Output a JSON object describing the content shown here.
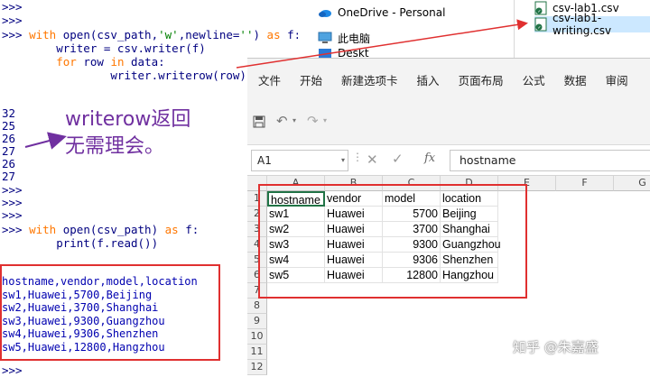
{
  "shell": {
    "prompt1": ">>>",
    "prompt2": ">>>",
    "line_with1": {
      "prompt": ">>> ",
      "kw_with": "with",
      "pre": " open(csv_path,",
      "str_w": "'w'",
      "mid": ",newline=",
      "str_empty": "''",
      "post": ") ",
      "kw_as": "as",
      "tail": " f:"
    },
    "line_writer": "        writer = csv.writer(f)",
    "line_for": {
      "indent": "        ",
      "kw_for": "for",
      "mid": " row ",
      "kw_in": "in",
      "tail": " data:"
    },
    "line_writerow": "                writer.writerow(row)",
    "returns": [
      "32",
      "25",
      "26",
      "27",
      "26",
      "27"
    ],
    "prompts_after": [
      ">>>",
      ">>>",
      ">>>"
    ],
    "line_with2": {
      "prompt": ">>> ",
      "kw_with": "with",
      "pre": " open(csv_path) ",
      "kw_as": "as",
      "tail": " f:"
    },
    "line_print": "        print(f.read())",
    "output_lines": [
      "hostname,vendor,model,location",
      "sw1,Huawei,5700,Beijing",
      "sw2,Huawei,3700,Shanghai",
      "sw3,Huawei,9300,Guangzhou",
      "sw4,Huawei,9306,Shenzhen",
      "sw5,Huawei,12800,Hangzhou"
    ],
    "final_prompt": ">>>"
  },
  "annotation": {
    "line1": "writerow返回",
    "line2": "无需理会。"
  },
  "explorer": {
    "onedrive": "OneDrive - Personal",
    "thispc": "此电脑",
    "desktop": "Deskt",
    "file1": "csv-lab1.csv",
    "file2": "csv-lab1-writing.csv"
  },
  "excel": {
    "tabs": [
      "文件",
      "开始",
      "新建选项卡",
      "插入",
      "页面布局",
      "公式",
      "数据",
      "审阅"
    ],
    "namebox": "A1",
    "formula": "hostname",
    "fx_symbol": "fx",
    "columns": [
      "A",
      "B",
      "C",
      "D",
      "E",
      "F",
      "G"
    ],
    "rows": [
      "1",
      "2",
      "3",
      "4",
      "5",
      "6",
      "7",
      "8",
      "9",
      "10",
      "11",
      "12"
    ],
    "data": [
      [
        "hostname",
        "vendor",
        "model",
        "location"
      ],
      [
        "sw1",
        "Huawei",
        "5700",
        "Beijing"
      ],
      [
        "sw2",
        "Huawei",
        "3700",
        "Shanghai"
      ],
      [
        "sw3",
        "Huawei",
        "9300",
        "Guangzhou"
      ],
      [
        "sw4",
        "Huawei",
        "9306",
        "Shenzhen"
      ],
      [
        "sw5",
        "Huawei",
        "12800",
        "Hangzhou"
      ]
    ]
  },
  "watermark": "知乎 @朱嘉盛",
  "colors": {
    "annotation": "#7030a0",
    "highlight_box": "#e03030",
    "excel_green": "#217346",
    "keyword": "#ff7700",
    "string": "#008000"
  }
}
